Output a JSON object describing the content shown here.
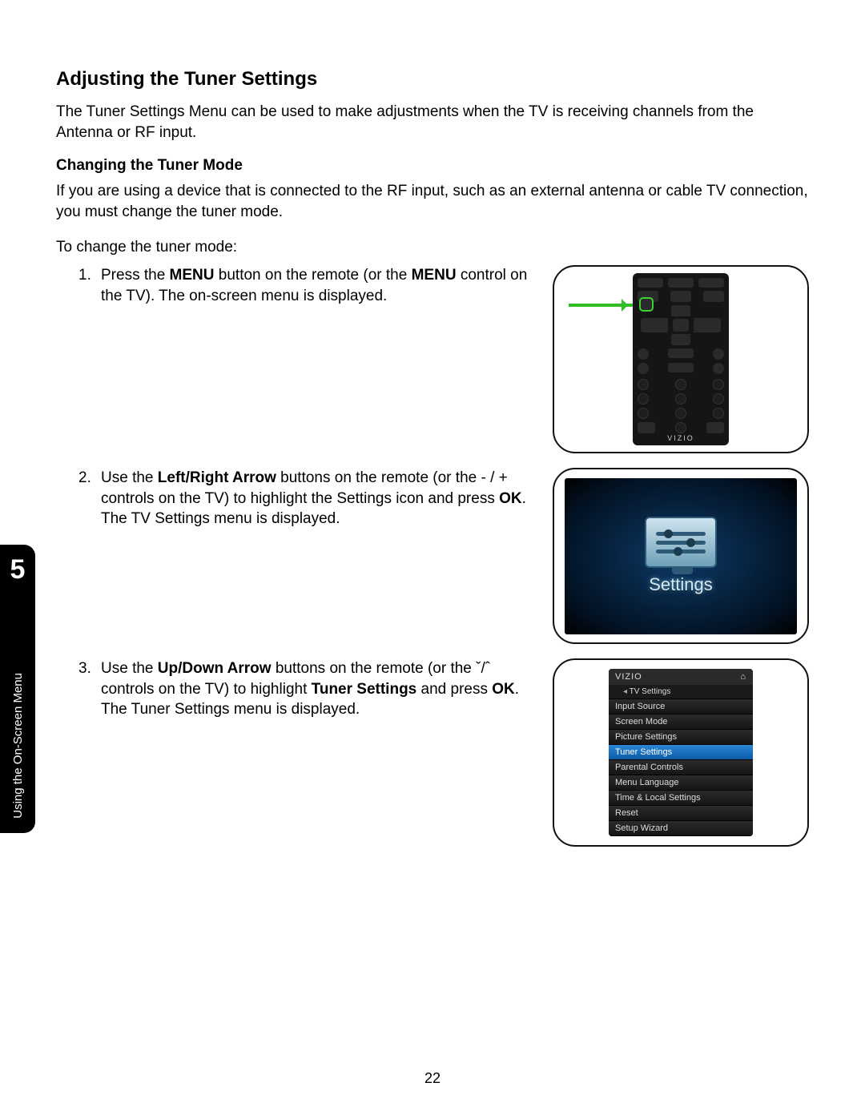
{
  "heading": "Adjusting the Tuner Settings",
  "intro": "The Tuner Settings Menu can be used to make adjustments when the TV is receiving channels from the Antenna or RF input.",
  "sub_heading": "Changing the Tuner Mode",
  "sub_body": "If you are using a device that is connected to the RF input, such as an external antenna or cable TV connection, you must change the tuner mode.",
  "lead": "To change the tuner mode:",
  "steps": {
    "s1": {
      "num": "1.",
      "pre": "Press the ",
      "b1": "MENU",
      "mid": " button on the remote (or the ",
      "b2": "MENU",
      "post": " control on the TV). The on-screen menu is displayed."
    },
    "s2": {
      "num": "2.",
      "pre": "Use the ",
      "b1": "Left/Right Arrow",
      "mid": " buttons on the remote (or the - / + controls on the TV) to highlight the Settings icon and press ",
      "b2": "OK",
      "post": ". The TV Settings menu is displayed."
    },
    "s3": {
      "num": "3.",
      "pre": "Use the ",
      "b1": "Up/Down Arrow",
      "mid": " buttons on the remote (or the ˇ/ˆ controls on the TV) to highlight ",
      "b2": "Tuner Settings",
      "mid2": " and press ",
      "b3": "OK",
      "post": ". The Tuner Settings menu is displayed."
    }
  },
  "remote_brand": "VIZIO",
  "fig2_label": "Settings",
  "menu": {
    "brand": "VIZIO",
    "sub": "TV Settings",
    "items": [
      "Input Source",
      "Screen Mode",
      "Picture Settings",
      "Tuner Settings",
      "Parental Controls",
      "Menu Language",
      "Time & Local Settings",
      "Reset",
      "Setup Wizard"
    ],
    "highlight_index": 3
  },
  "side": {
    "chapter": "5",
    "label": "Using the On-Screen Menu"
  },
  "page_number": "22"
}
